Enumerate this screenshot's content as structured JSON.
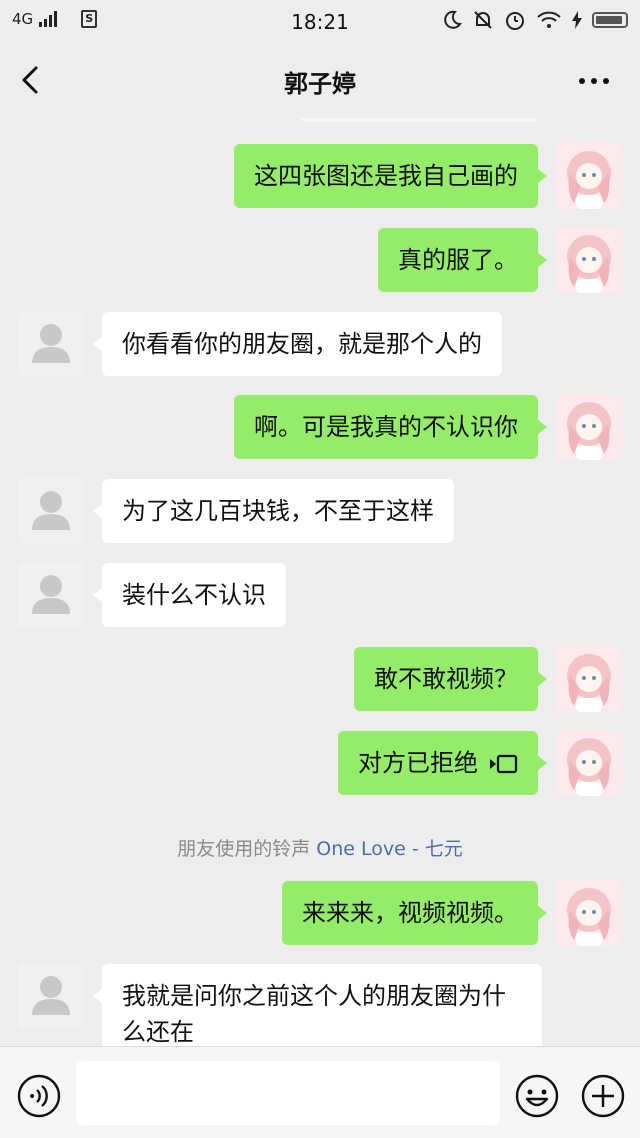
{
  "status_bar": {
    "network": "4G",
    "sim_label": "S",
    "time": "18:21"
  },
  "nav": {
    "title": "郭子婷"
  },
  "messages": [
    {
      "side": "right",
      "text": "这四张图还是我自己画的"
    },
    {
      "side": "right",
      "text": "真的服了。"
    },
    {
      "side": "left",
      "text": "你看看你的朋友圈，就是那个人的"
    },
    {
      "side": "right",
      "text": "啊。可是我真的不认识你"
    },
    {
      "side": "left",
      "text": "为了这几百块钱，不至于这样"
    },
    {
      "side": "left",
      "text": "装什么不认识"
    },
    {
      "side": "right",
      "text": "敢不敢视频？"
    },
    {
      "side": "right",
      "text": "对方已拒绝"
    },
    {
      "side": "right",
      "text": "来来来，视频视频。"
    },
    {
      "side": "left",
      "text": "我就是问你之前这个人的朋友圈为什么还在"
    }
  ],
  "system_notice": {
    "prefix": "朋友使用的铃声",
    "song": "One Love - 七元"
  },
  "input": {
    "value": ""
  },
  "colors": {
    "sent_bubble": "#95ec69",
    "received_bubble": "#ffffff",
    "background": "#ededed",
    "link": "#4a6fa5"
  },
  "icons": {
    "back": "chevron-left-icon",
    "more": "more-dots-icon",
    "voice": "voice-icon",
    "emoji": "emoji-icon",
    "plus": "plus-icon",
    "video": "video-call-icon"
  }
}
